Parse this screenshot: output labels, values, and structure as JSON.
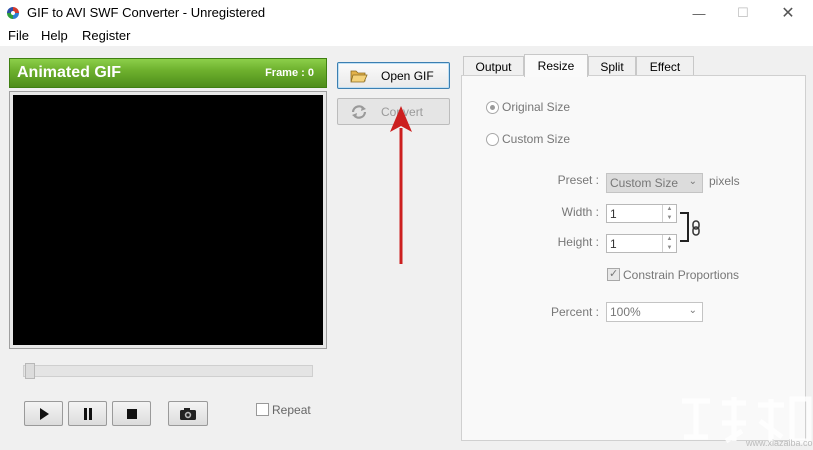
{
  "window": {
    "title": "GIF to AVI SWF Converter - Unregistered"
  },
  "menu": {
    "items": [
      "File",
      "Help",
      "Register"
    ]
  },
  "preview": {
    "title": "Animated GIF",
    "frame_label": "Frame :",
    "frame_value": "0",
    "seek_position": 0
  },
  "playback": {
    "repeat_label": "Repeat",
    "repeat_checked": false
  },
  "actions": {
    "open_label": "Open GIF",
    "convert_label": "Convert"
  },
  "tabs": {
    "items": [
      "Output",
      "Resize",
      "Split",
      "Effect"
    ],
    "active": "Resize"
  },
  "resize": {
    "original_size_label": "Original Size",
    "custom_size_label": "Custom Size",
    "selected_mode": "Original Size",
    "preset_label": "Preset :",
    "preset_value": "Custom Size",
    "pixels_label": "pixels",
    "width_label": "Width :",
    "width_value": "1",
    "height_label": "Height :",
    "height_value": "1",
    "constrain_label": "Constrain Proportions",
    "constrain_checked": true,
    "percent_label": "Percent :",
    "percent_value": "100%"
  },
  "colors": {
    "header_green": "#6eb12e",
    "annotation_red": "#cc1f1f",
    "focus_blue": "#3c7fb1"
  },
  "watermark": {
    "text": "www.xiazaiba.com"
  }
}
